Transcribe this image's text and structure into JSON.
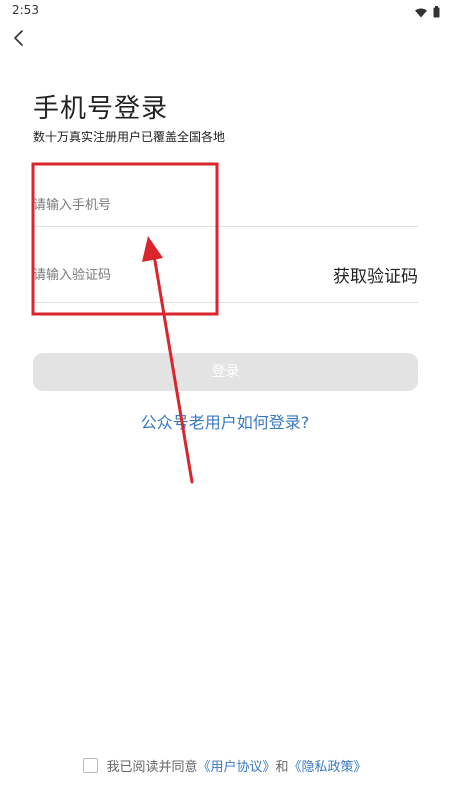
{
  "status_bar": {
    "time": "2:53",
    "icons": [
      "wifi-icon",
      "battery-icon"
    ]
  },
  "nav": {
    "back_icon": "chevron-left-icon"
  },
  "header": {
    "title": "手机号登录",
    "subtitle": "数十万真实注册用户已覆盖全国各地"
  },
  "form": {
    "phone_placeholder": "请输入手机号",
    "code_placeholder": "请输入验证码",
    "get_code_label": "获取验证码",
    "login_label": "登录"
  },
  "legacy_link": "公众号老用户如何登录?",
  "agreement": {
    "prefix": "我已阅读并同意",
    "user_agreement": "《用户协议》",
    "conjunction": "和",
    "privacy_policy": "《隐私政策》"
  },
  "colors": {
    "accent": "#3a79c4",
    "annotation": "#d9262c",
    "button_disabled": "#e3e3e3"
  }
}
